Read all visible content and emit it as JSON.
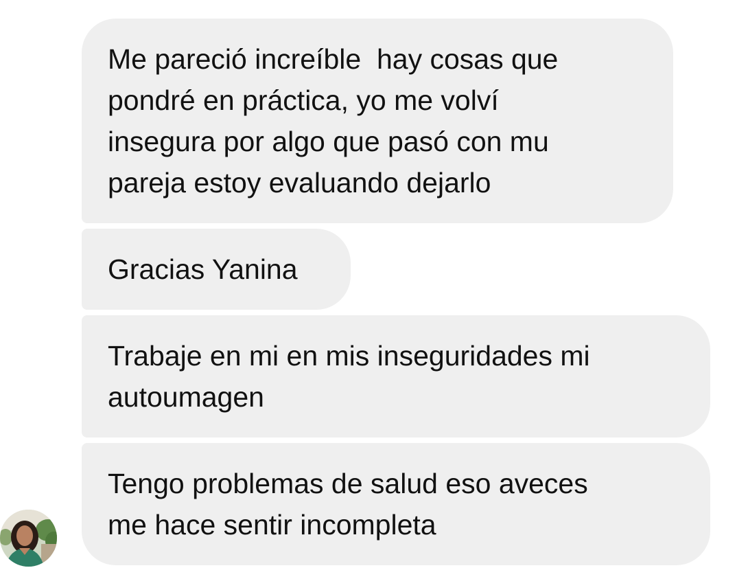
{
  "conversation": {
    "messages": [
      {
        "text": "Me pareció increíble  hay cosas que\npondré en práctica, yo me volví\ninsegura por algo que pasó con mu\npareja estoy evaluando dejarlo"
      },
      {
        "text": "Gracias Yanina"
      },
      {
        "text": "Trabaje en mi en mis inseguridades mi\nautoumagen"
      },
      {
        "text": "Tengo problemas de salud eso aveces\nme hace sentir incompleta"
      }
    ],
    "sender": {
      "avatar_icon": "profile-photo",
      "bubble_color": "#efefef"
    }
  }
}
